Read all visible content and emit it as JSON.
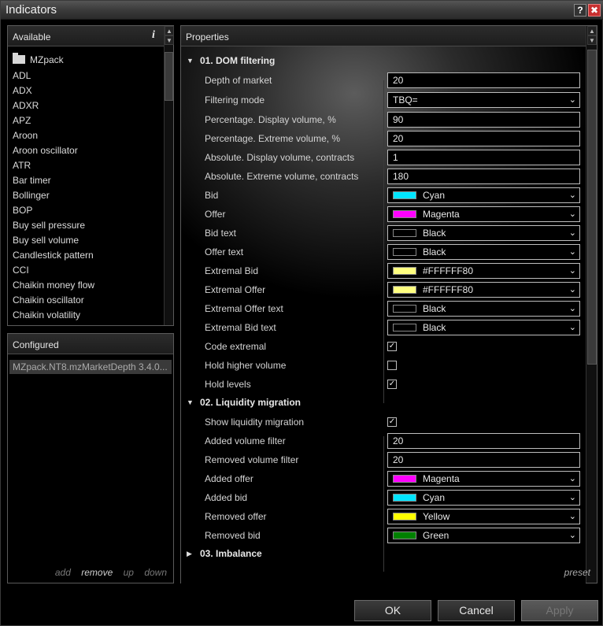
{
  "window": {
    "title": "Indicators",
    "help_label": "?",
    "close_label": "✖"
  },
  "available": {
    "header": "Available",
    "info_label": "i",
    "folder": "MZpack",
    "items": [
      "ADL",
      "ADX",
      "ADXR",
      "APZ",
      "Aroon",
      "Aroon oscillator",
      "ATR",
      "Bar timer",
      "Bollinger",
      "BOP",
      "Buy sell pressure",
      "Buy sell volume",
      "Candlestick pattern",
      "CCI",
      "Chaikin money flow",
      "Chaikin oscillator",
      "Chaikin volatility"
    ]
  },
  "configured": {
    "header": "Configured",
    "item": "MZpack.NT8.mzMarketDepth 3.4.0...",
    "links": {
      "add": "add",
      "remove": "remove",
      "up": "up",
      "down": "down"
    }
  },
  "properties": {
    "header": "Properties",
    "sections": [
      {
        "label": "01. DOM filtering",
        "expanded": true
      },
      {
        "label": "02. Liquidity migration",
        "expanded": true
      },
      {
        "label": "03. Imbalance",
        "expanded": false
      }
    ],
    "dom": {
      "depth_of_market": {
        "name": "Depth of market",
        "value": "20"
      },
      "filtering_mode": {
        "name": "Filtering mode",
        "value": "TBQ="
      },
      "pct_display": {
        "name": "Percentage. Display volume, %",
        "value": "90"
      },
      "pct_extreme": {
        "name": "Percentage. Extreme volume, %",
        "value": "20"
      },
      "abs_display": {
        "name": "Absolute. Display volume, contracts",
        "value": "1"
      },
      "abs_extreme": {
        "name": "Absolute. Extreme volume, contracts",
        "value": "180"
      },
      "bid": {
        "name": "Bid",
        "value": "Cyan",
        "color": "#00e5ff"
      },
      "offer": {
        "name": "Offer",
        "value": "Magenta",
        "color": "#ff00ff"
      },
      "bid_text": {
        "name": "Bid text",
        "value": "Black",
        "color": "#000000"
      },
      "offer_text": {
        "name": "Offer text",
        "value": "Black",
        "color": "#000000"
      },
      "extremal_bid": {
        "name": "Extremal Bid",
        "value": "#FFFFFF80",
        "color": "#ffff80"
      },
      "extremal_offer": {
        "name": "Extremal Offer",
        "value": "#FFFFFF80",
        "color": "#ffff80"
      },
      "extremal_offer_text": {
        "name": "Extremal Offer text",
        "value": "Black",
        "color": "#000000"
      },
      "extremal_bid_text": {
        "name": "Extremal Bid text",
        "value": "Black",
        "color": "#000000"
      },
      "code_extremal": {
        "name": "Code extremal",
        "checked": true
      },
      "hold_higher_volume": {
        "name": "Hold higher volume",
        "checked": false
      },
      "hold_levels": {
        "name": "Hold levels",
        "checked": true
      }
    },
    "liquidity": {
      "show": {
        "name": "Show liquidity migration",
        "checked": true
      },
      "added_filter": {
        "name": "Added volume filter",
        "value": "20"
      },
      "removed_filter": {
        "name": "Removed volume filter",
        "value": "20"
      },
      "added_offer": {
        "name": "Added offer",
        "value": "Magenta",
        "color": "#ff00ff"
      },
      "added_bid": {
        "name": "Added bid",
        "value": "Cyan",
        "color": "#00e5ff"
      },
      "removed_offer": {
        "name": "Removed offer",
        "value": "Yellow",
        "color": "#ffff00"
      },
      "removed_bid": {
        "name": "Removed bid",
        "value": "Green",
        "color": "#008000"
      }
    },
    "preset_label": "preset"
  },
  "buttons": {
    "ok": "OK",
    "cancel": "Cancel",
    "apply": "Apply"
  }
}
